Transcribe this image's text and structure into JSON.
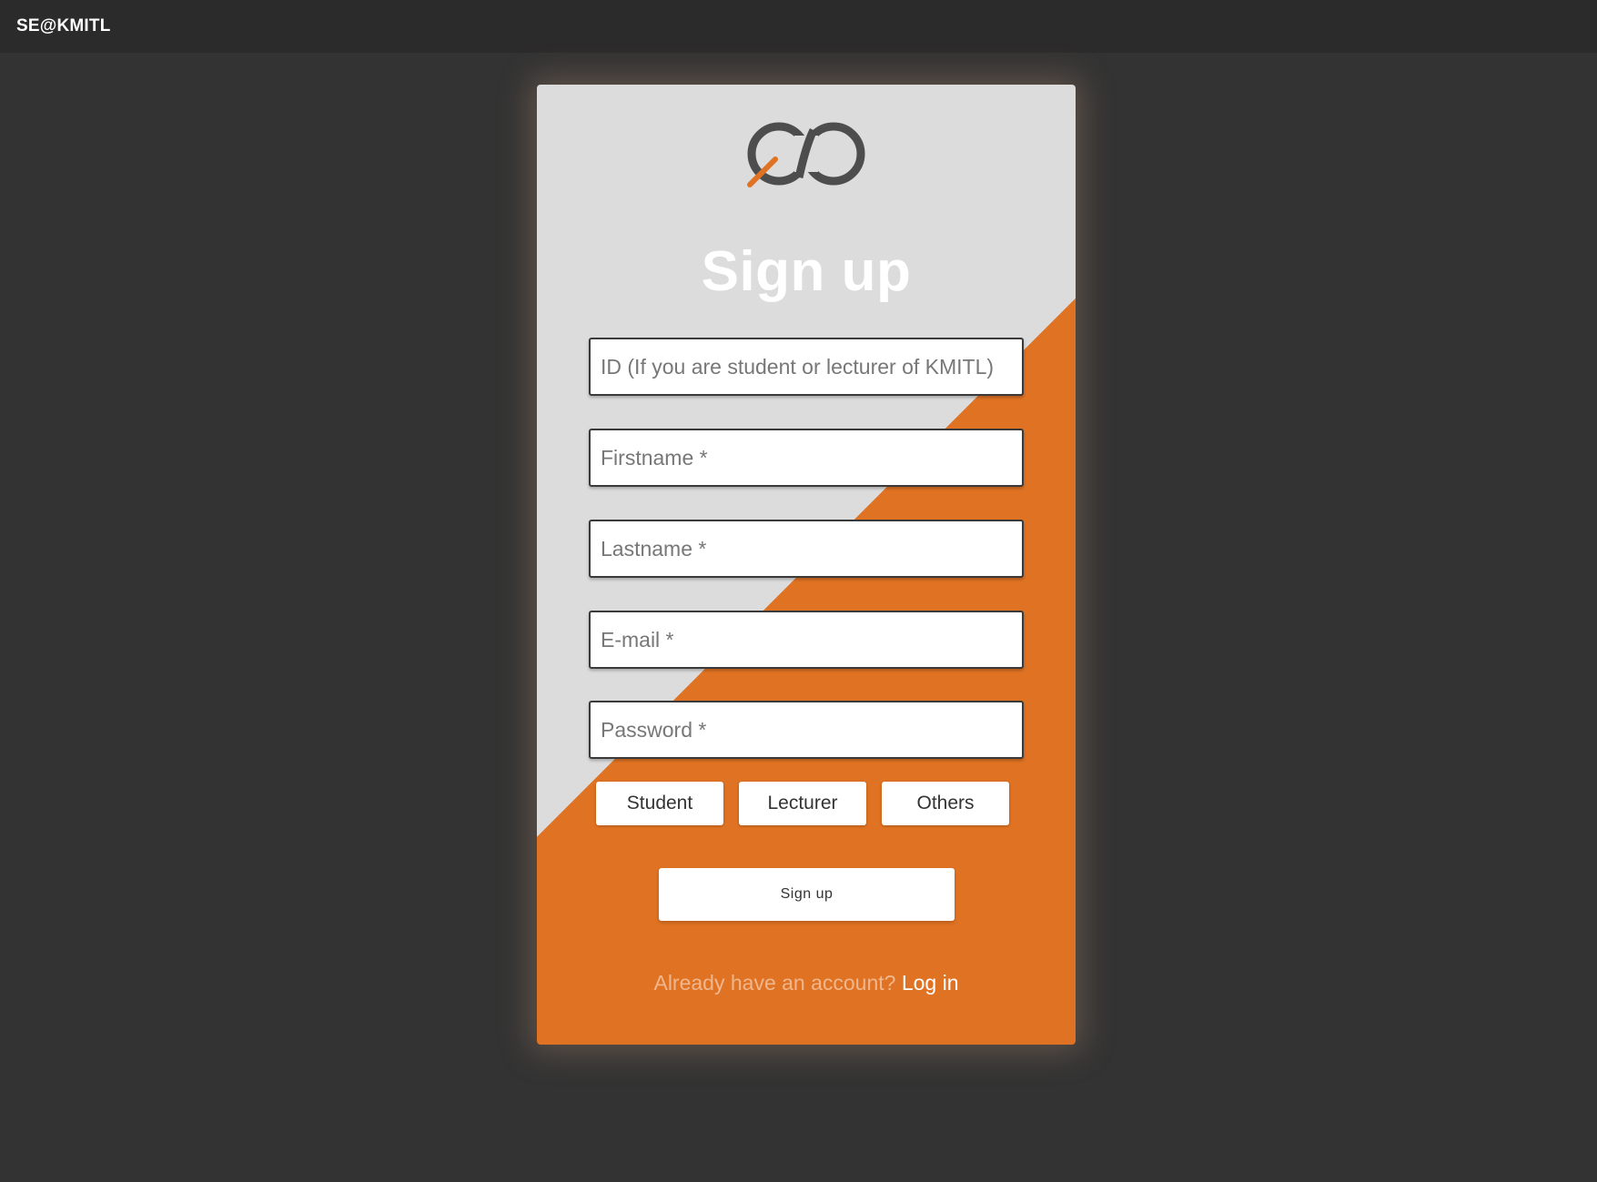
{
  "topbar": {
    "brand": "SE@KMITL"
  },
  "card": {
    "title": "Sign up",
    "logo_icon": "infinity-logo-icon",
    "colors": {
      "light": "#dcdcdc",
      "accent": "#e07323",
      "logo": "#4d4d4d",
      "logo_accent": "#e07323"
    }
  },
  "form": {
    "id_placeholder": "ID (If you are student or lecturer of KMITL)",
    "firstname_placeholder": "Firstname *",
    "lastname_placeholder": "Lastname *",
    "email_placeholder": "E-mail *",
    "password_placeholder": "Password *",
    "roles": [
      "Student",
      "Lecturer",
      "Others"
    ],
    "submit_label": "Sign up"
  },
  "footer": {
    "question": "Already have an account?",
    "login_label": "Log in"
  }
}
